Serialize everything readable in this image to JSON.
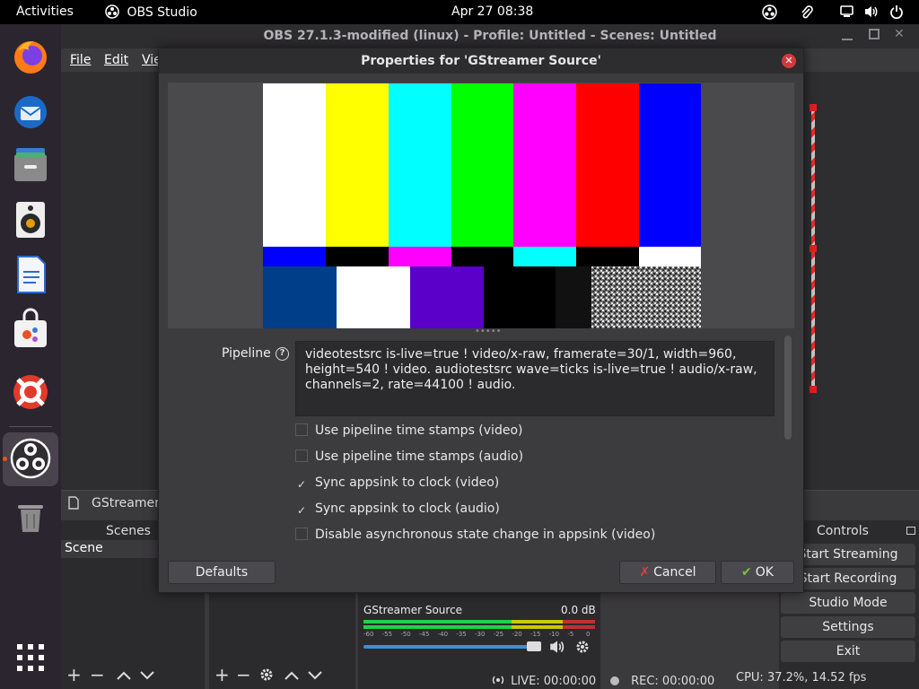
{
  "topbar": {
    "activities": "Activities",
    "app_name": "OBS Studio",
    "clock": "Apr 27  08:38"
  },
  "window": {
    "title": "OBS 27.1.3-modified (linux) - Profile: Untitled - Scenes: Untitled"
  },
  "menu": {
    "file": "File",
    "edit": "Edit",
    "view": "Vie"
  },
  "source_label": "GStreamer",
  "scenes": {
    "title": "Scenes",
    "item": "Scene"
  },
  "controls": {
    "title": "Controls",
    "start_streaming": "Start Streaming",
    "start_recording": "Start Recording",
    "studio_mode": "Studio Mode",
    "settings": "Settings",
    "exit": "Exit"
  },
  "mixer": {
    "source_name": "GStreamer Source",
    "db": "0.0 dB",
    "ticks": [
      "-60",
      "-55",
      "-50",
      "-45",
      "-40",
      "-35",
      "-30",
      "-25",
      "-20",
      "-15",
      "-10",
      "-5",
      "0"
    ],
    "volume": 0.92
  },
  "status": {
    "live": "LIVE: 00:00:00",
    "rec": "REC: 00:00:00",
    "cpu": "CPU: 37.2%, 14.52 fps"
  },
  "dialog": {
    "title": "Properties for 'GStreamer Source'",
    "pipeline_label": "Pipeline",
    "pipeline_value": "videotestsrc is-live=true ! video/x-raw, framerate=30/1, width=960, height=540 ! video. audiotestsrc wave=ticks is-live=true ! audio/x-raw, channels=2, rate=44100 ! audio.",
    "options": [
      {
        "label": "Use pipeline time stamps (video)",
        "checked": false
      },
      {
        "label": "Use pipeline time stamps (audio)",
        "checked": false
      },
      {
        "label": "Sync appsink to clock (video)",
        "checked": true
      },
      {
        "label": "Sync appsink to clock (audio)",
        "checked": true
      },
      {
        "label": "Disable asynchronous state change in appsink (video)",
        "checked": false
      }
    ],
    "defaults": "Defaults",
    "cancel": "Cancel",
    "ok": "OK"
  },
  "colors": {
    "accent": "#e95420",
    "close": "#d13a3a",
    "meter_green": "#1fd24a",
    "volume_blue": "#3a8fdc"
  }
}
